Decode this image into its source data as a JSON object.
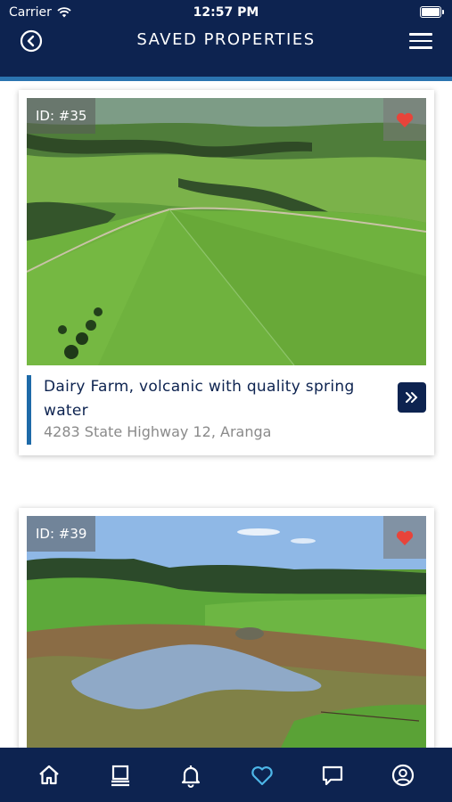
{
  "status_bar": {
    "carrier": "Carrier",
    "time": "12:57 PM"
  },
  "header": {
    "title": "SAVED PROPERTIES",
    "back_icon": "back-circle-icon",
    "menu_icon": "hamburger-menu-icon"
  },
  "properties": [
    {
      "id_label": "ID: #35",
      "title": "Dairy Farm, volcanic with quality spring water",
      "address": "4283 State Highway 12, Aranga",
      "favorited": true
    },
    {
      "id_label": "ID: #39",
      "favorited": true
    }
  ],
  "bottom_nav": [
    {
      "name": "home",
      "icon": "home-icon",
      "active": false
    },
    {
      "name": "listings",
      "icon": "listings-icon",
      "active": false
    },
    {
      "name": "notifications",
      "icon": "bell-icon",
      "active": false
    },
    {
      "name": "saved",
      "icon": "heart-icon",
      "active": true
    },
    {
      "name": "messages",
      "icon": "chat-icon",
      "active": false
    },
    {
      "name": "profile",
      "icon": "user-icon",
      "active": false
    }
  ],
  "colors": {
    "header_bg": "#0d2350",
    "accent_blue": "#2b74b0",
    "heart_red": "#e8443a",
    "active_nav": "#4db6e8"
  }
}
